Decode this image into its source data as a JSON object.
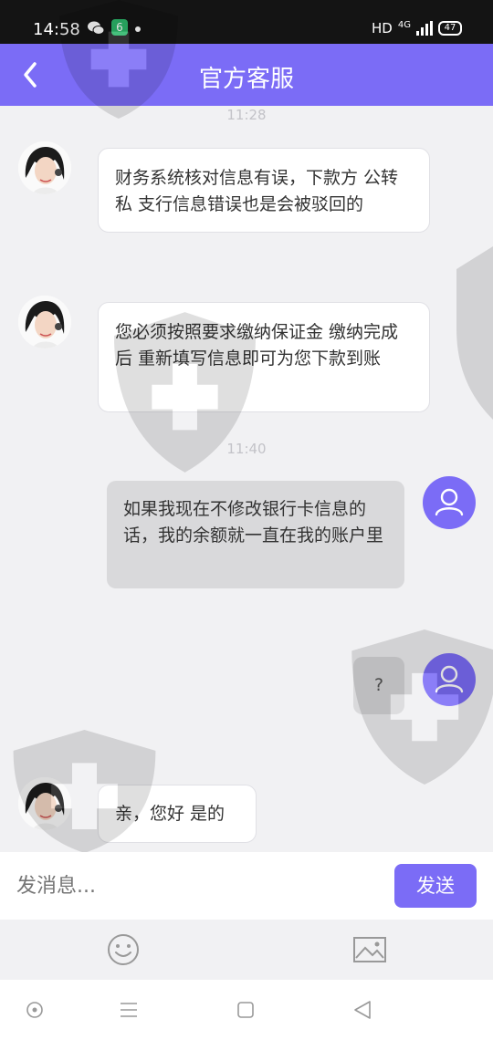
{
  "status_bar": {
    "time": "14:58",
    "app_badge": "6",
    "hd": "HD",
    "network": "4G",
    "battery": "47"
  },
  "header": {
    "title": "官方客服"
  },
  "messages": {
    "ts1": "11:28",
    "cs1": "财务系统核对信息有误，下款方 公转私  支行信息错误也是会被驳回的",
    "cs2": "您必须按照要求缴纳保证金 缴纳完成后 重新填写信息即可为您下款到账",
    "ts2": "11:40",
    "me1": "如果我现在不修改银行卡信息的话，我的余额就一直在我的账户里",
    "me2": "?",
    "cs3": "亲，您好  是的"
  },
  "input": {
    "placeholder": "发消息...",
    "send_label": "发送"
  },
  "colors": {
    "accent": "#7b6cf6",
    "background": "#f1f1f3",
    "my_bubble": "#d9d9db",
    "status_bar": "#141414"
  },
  "icons": {
    "back": "chevron-left-icon",
    "emoji": "smiley-icon",
    "image": "image-icon",
    "nav": [
      "circle-dot-icon",
      "menu-icon",
      "square-icon",
      "triangle-back-icon"
    ]
  }
}
